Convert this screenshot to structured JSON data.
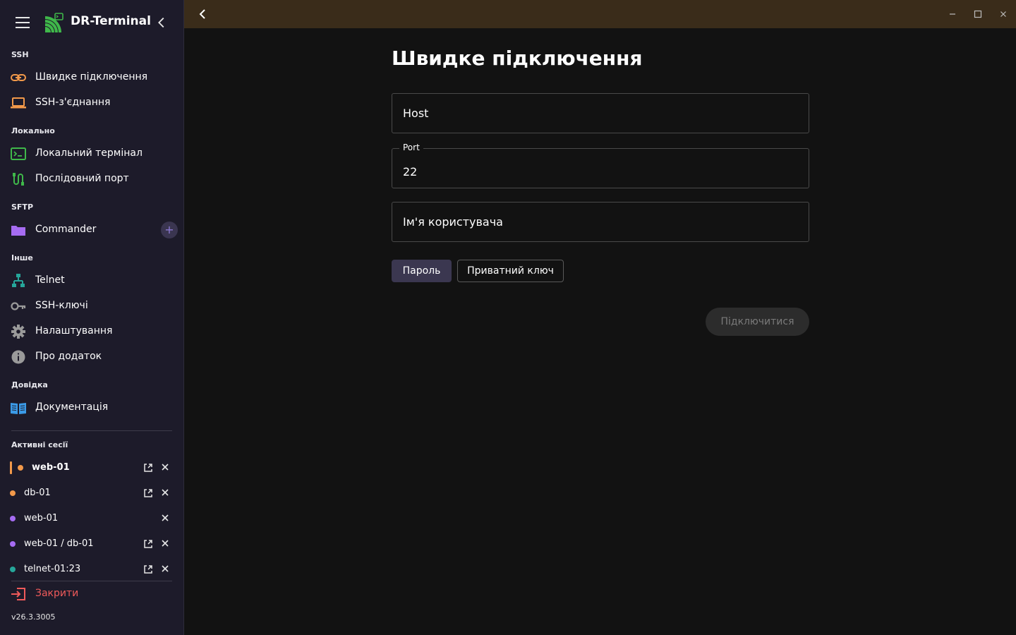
{
  "app": {
    "name": "DR-Terminal",
    "version": "v26.3.3005"
  },
  "sidebar": {
    "sections": {
      "ssh": "SSH",
      "local": "Локально",
      "sftp": "SFTP",
      "other": "Інше",
      "help": "Довідка",
      "active_sessions": "Активні сесії"
    },
    "items": {
      "quick_connect": "Швидке підключення",
      "ssh_connections": "SSH-з'єднання",
      "local_terminal": "Локальний термінал",
      "serial_port": "Послідовний порт",
      "commander": "Commander",
      "commander_add": "+",
      "telnet": "Telnet",
      "ssh_keys": "SSH-ключі",
      "settings": "Налаштування",
      "about": "Про додаток",
      "docs": "Документація"
    },
    "sessions": [
      {
        "name": "web-01",
        "color": "#f2994a",
        "active": true
      },
      {
        "name": "db-01",
        "color": "#f2994a"
      },
      {
        "name": "web-01",
        "color": "#a66cf2"
      },
      {
        "name": "web-01 / db-01",
        "color": "#a66cf2"
      },
      {
        "name": "telnet-01:23",
        "color": "#26a69a"
      }
    ],
    "close_label": "Закрити"
  },
  "form": {
    "title": "Швидке підключення",
    "host_placeholder": "Host",
    "port_label": "Port",
    "port_value": "22",
    "username_placeholder": "Ім'я користувача",
    "auth_password": "Пароль",
    "auth_private_key": "Приватний ключ",
    "connect": "Підключитися"
  },
  "colors": {
    "sidebar_bg": "#1d1b2a",
    "topbar_bg": "#3a2c1a",
    "main_bg": "#121212",
    "accent_orange": "#f2994a",
    "accent_purple": "#a66cf2",
    "accent_teal": "#26a69a",
    "danger": "#f05a5a",
    "brand_green": "#3fb84a"
  }
}
